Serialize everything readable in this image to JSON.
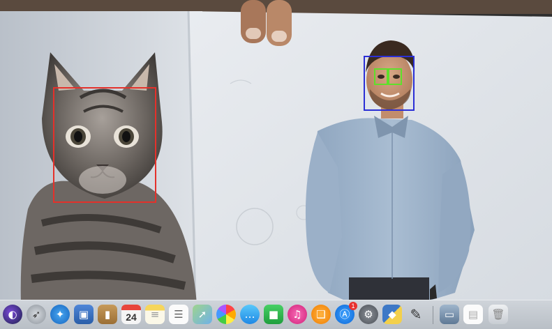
{
  "scene": {
    "detections": {
      "cat_face": {
        "color": "#e4312b"
      },
      "person_face": {
        "color": "#2b2fd6"
      },
      "eyes": {
        "color": "#5ee02a"
      }
    }
  },
  "dock": {
    "calendar_day": "24",
    "app_store_badge": "1",
    "apps": [
      {
        "name": "Siri",
        "icon": "siri-icon"
      },
      {
        "name": "Launchpad",
        "icon": "launchpad-icon"
      },
      {
        "name": "Safari",
        "icon": "safari-icon"
      },
      {
        "name": "Preview",
        "icon": "preview-icon"
      },
      {
        "name": "Contacts",
        "icon": "contacts-icon"
      },
      {
        "name": "Calendar",
        "icon": "calendar-icon"
      },
      {
        "name": "Notes",
        "icon": "notes-icon"
      },
      {
        "name": "Reminders",
        "icon": "reminders-icon"
      },
      {
        "name": "Maps",
        "icon": "maps-icon"
      },
      {
        "name": "Photos",
        "icon": "photos-icon"
      },
      {
        "name": "Messages",
        "icon": "messages-icon"
      },
      {
        "name": "FaceTime",
        "icon": "facetime-icon"
      },
      {
        "name": "iTunes",
        "icon": "itunes-icon"
      },
      {
        "name": "iBooks",
        "icon": "ibooks-icon"
      },
      {
        "name": "App Store",
        "icon": "app-store-icon"
      },
      {
        "name": "System Preferences",
        "icon": "system-preferences-icon"
      },
      {
        "name": "Python Launcher",
        "icon": "python-icon"
      },
      {
        "name": "Pencil",
        "icon": "pencil-icon"
      },
      {
        "name": "Downloads",
        "icon": "downloads-folder-icon"
      },
      {
        "name": "Document",
        "icon": "document-icon"
      },
      {
        "name": "Trash",
        "icon": "trash-icon"
      }
    ]
  }
}
